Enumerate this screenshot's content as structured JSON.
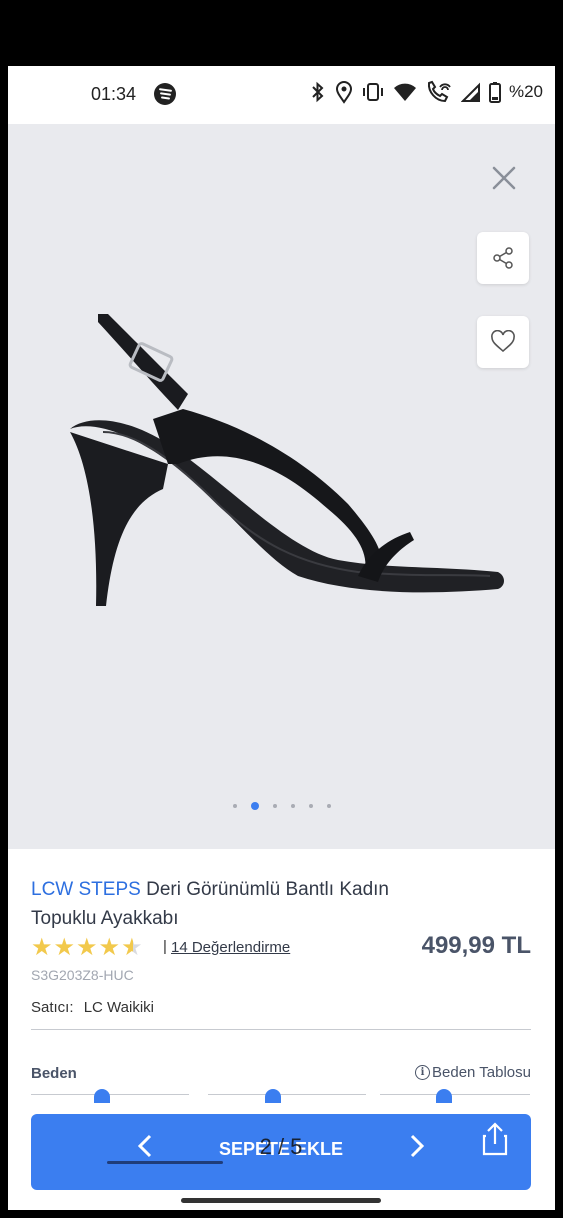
{
  "status_bar": {
    "time": "01:34",
    "battery": "%20",
    "icons": [
      "spotify-icon",
      "bluetooth-icon",
      "location-icon",
      "vibrate-icon",
      "wifi-icon",
      "wifi-calling-icon",
      "signal-icon",
      "battery-icon"
    ]
  },
  "gallery": {
    "image_count": 6,
    "active_index": 1
  },
  "product": {
    "brand": "LCW STEPS",
    "name": "Deri Görünümlü Bantlı Kadın Topuklu Ayakkabı",
    "rating": 4.5,
    "review_separator": "|",
    "review_link": "14 Değerlendirme",
    "price": "499,99 TL",
    "sku": "S3G203Z8-HUC",
    "seller_label": "Satıcı:",
    "seller_name": "LC Waikiki"
  },
  "size": {
    "label": "Beden",
    "table_link": "Beden Tablosu"
  },
  "bottom_bar": {
    "add_to_cart": "SEPETE EKLE",
    "image_counter": "2 / 5"
  },
  "colors": {
    "accent": "#3b7ef0",
    "brand_text": "#2d6fe0",
    "star": "#f2c94c",
    "gallery_bg": "#e9eaee"
  }
}
